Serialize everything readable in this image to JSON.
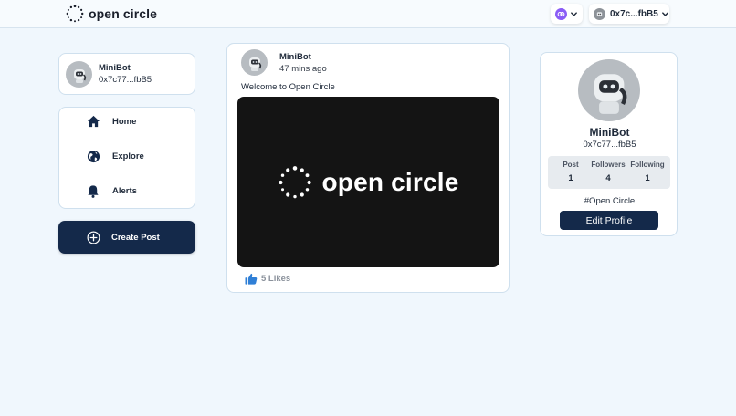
{
  "header": {
    "logo_text": "open circle",
    "wallet_address": "0x7c...fbB5"
  },
  "left_profile": {
    "name": "MiniBot",
    "address": "0x7c77...fbB5"
  },
  "nav": {
    "items": [
      {
        "label": "Home",
        "icon": "home-icon"
      },
      {
        "label": "Explore",
        "icon": "globe-icon"
      },
      {
        "label": "Alerts",
        "icon": "bell-icon"
      }
    ]
  },
  "create_post": {
    "label": "Create Post",
    "icon": "plus-circle-icon"
  },
  "post": {
    "author": "MiniBot",
    "time": "47 mins ago",
    "text": "Welcome to Open Circle",
    "image_logo_text": "open circle",
    "likes": "5 Likes"
  },
  "right_profile": {
    "name": "MiniBot",
    "address": "0x7c77...fbB5",
    "stats": [
      {
        "label": "Post",
        "value": "1"
      },
      {
        "label": "Followers",
        "value": "4"
      },
      {
        "label": "Following",
        "value": "1"
      }
    ],
    "tag": "#Open Circle",
    "edit_label": "Edit Profile"
  },
  "colors": {
    "background": "#f0f7fd",
    "primary_navy": "#14294a",
    "chain_purple": "#8a5cf6",
    "like_blue": "#2f7fd6"
  }
}
